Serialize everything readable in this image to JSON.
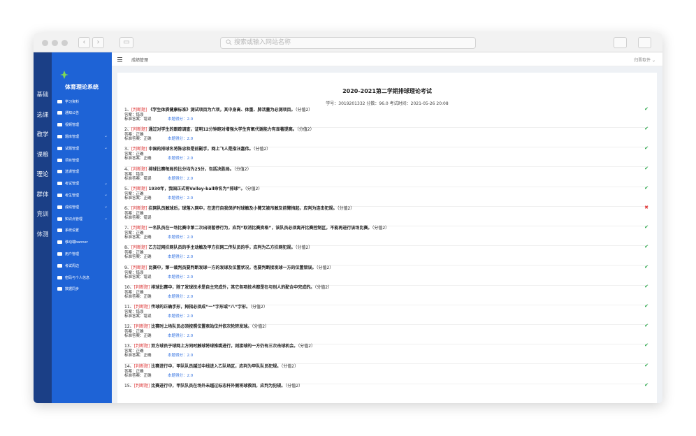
{
  "browser": {
    "address_placeholder": "搜索或输入网站名称",
    "colors": {
      "chrome": "#f2f2f2"
    }
  },
  "rail": [
    "基础",
    "选课",
    "教学",
    "课粮",
    "理论",
    "群体",
    "竞训",
    "体测"
  ],
  "rail_active": 4,
  "sidebar": {
    "title": "体育理论系统",
    "items": [
      {
        "label": "学习资料",
        "icon": "book-icon",
        "chevron": false
      },
      {
        "label": "通知公告",
        "icon": "mail-icon",
        "chevron": false
      },
      {
        "label": "视频管理",
        "icon": "video-icon",
        "chevron": false
      },
      {
        "label": "题库管理",
        "icon": "list-icon",
        "chevron": true
      },
      {
        "label": "试题管理",
        "icon": "grid-icon",
        "chevron": true
      },
      {
        "label": "项目管理",
        "icon": "wrench-icon",
        "chevron": false
      },
      {
        "label": "选课管理",
        "icon": "monitor-icon",
        "chevron": false
      },
      {
        "label": "考试管理",
        "icon": "bell-icon",
        "chevron": true
      },
      {
        "label": "考生管理",
        "icon": "users-icon",
        "chevron": true
      },
      {
        "label": "成绩管理",
        "icon": "table-icon",
        "chevron": true
      },
      {
        "label": "知识点管理",
        "icon": "tag-icon",
        "chevron": true
      },
      {
        "label": "系统设置",
        "icon": "gear-icon",
        "chevron": false
      },
      {
        "label": "移动端banner",
        "icon": "mail-icon",
        "chevron": false
      },
      {
        "label": "用户管理",
        "icon": "user-icon",
        "chevron": false
      },
      {
        "label": "考试周边",
        "icon": "mail-icon",
        "chevron": false
      },
      {
        "label": "密码与个人信息",
        "icon": "key-icon",
        "chevron": false
      },
      {
        "label": "数据同步",
        "icon": "sync-icon",
        "chevron": false
      }
    ],
    "colors": {
      "rail": "#1b3f86",
      "menu": "#1e63d6"
    }
  },
  "topbar": {
    "breadcrumb": "成绩管理",
    "user": "归晋软件 ⌄"
  },
  "exam": {
    "title": "2020-2021第二学期排球理论考试",
    "meta": "学号：3019201332 分数：96.0 考试时间：2021-05-26 20:08"
  },
  "questions": [
    {
      "num": "1、",
      "tag": "[判断题]",
      "stem": "《学生体质健康标准》测试项目为六项，其中身高、体重、肺活量为必测项目。",
      "score": "（分值2）",
      "answer": "答案：错误",
      "standard": "标准答案：错误",
      "got": "本题得分：2.0",
      "correct": true
    },
    {
      "num": "2、",
      "tag": "[判断题]",
      "stem": "通过对学生的跟踪调查，证明12分钟跑对增强大学生有氧代谢能力有显著提高。",
      "score": "（分值2）",
      "answer": "答案：正确",
      "standard": "标准答案：正确",
      "got": "本题得分：2.0",
      "correct": true
    },
    {
      "num": "3、",
      "tag": "[判断题]",
      "stem": "中国的排球名将陈忠和是前副手，网上飞人是指汪嘉伟。",
      "score": "（分值2）",
      "answer": "答案：正确",
      "standard": "标准答案：正确",
      "got": "本题得分：2.0",
      "correct": true
    },
    {
      "num": "4、",
      "tag": "[判断题]",
      "stem": "排球比赛每局的比分均为25分，包括决胜局。",
      "score": "（分值2）",
      "answer": "答案：错误",
      "standard": "标准答案：错误",
      "got": "本题得分：2.0",
      "correct": true
    },
    {
      "num": "5、",
      "tag": "[判断题]",
      "stem": "1930年，我国正式将Volley-ball命名为“排球”。",
      "score": "（分值2）",
      "answer": "答案：正确",
      "standard": "标准答案：正确",
      "got": "本题得分：2.0",
      "correct": true
    },
    {
      "num": "6、",
      "tag": "[判断题]",
      "stem": "拦网队员触球后，球落入网中，在进行自我保护时球触及小臂又被吊触及前臂挡起，应判为连击犯规。",
      "score": "（分值2）",
      "answer": "答案：正确",
      "standard": "标准答案：错误",
      "got": "",
      "correct": false
    },
    {
      "num": "7、",
      "tag": "[判断题]",
      "stem": "一名队员在一场比赛中第二次出现暂停行为，应判“取消比赛资格”，该队员必须离开比赛控制区，不能再进行该场比赛。",
      "score": "（分值2）",
      "answer": "答案：正确",
      "standard": "标准答案：正确",
      "got": "本题得分：2.0",
      "correct": true
    },
    {
      "num": "8、",
      "tag": "[判断题]",
      "stem": "乙方过网拦网队员的手主动触及甲方拦网二传队员的手，应判为乙方拦网犯规。",
      "score": "（分值2）",
      "answer": "答案：正确",
      "standard": "标准答案：正确",
      "got": "本题得分：2.0",
      "correct": true
    },
    {
      "num": "9、",
      "tag": "[判断题]",
      "stem": "比赛中，第一裁判员要判断发球一方的发球及位置状况，也要判断接发球一方的位置错误。",
      "score": "（分值2）",
      "answer": "答案：错误",
      "standard": "标准答案：错误",
      "got": "本题得分：2.0",
      "correct": true
    },
    {
      "num": "10、",
      "tag": "[判断题]",
      "stem": "排球比赛中，除了发球技术是自主完成外，其它各项技术都是在与别人的配合中完成的。",
      "score": "（分值2）",
      "answer": "答案：正确",
      "standard": "标准答案：正确",
      "got": "本题得分：2.0",
      "correct": true
    },
    {
      "num": "11、",
      "tag": "[判断题]",
      "stem": "传球的正确手形，拇指必须成“一”字形或“八”字形。",
      "score": "（分值2）",
      "answer": "答案：错误",
      "standard": "标准答案：错误",
      "got": "本题得分：2.0",
      "correct": true
    },
    {
      "num": "12、",
      "tag": "[判断题]",
      "stem": "比赛时上场队员必须按照位置表站位并依次轮转发球。",
      "score": "（分值2）",
      "answer": "答案：正确",
      "standard": "标准答案：正确",
      "got": "本题得分：2.0",
      "correct": true
    },
    {
      "num": "13、",
      "tag": "[判断题]",
      "stem": "双方球员于球网上方同时触球将球推跳进行，则接球的一方仍有三次击球机会。",
      "score": "（分值2）",
      "answer": "答案：正确",
      "standard": "标准答案：正确",
      "got": "本题得分：2.0",
      "correct": true
    },
    {
      "num": "14、",
      "tag": "[判断题]",
      "stem": "比赛进行中，甲队队员越过中线进入乙队场区，应判为甲队队员犯规。",
      "score": "（分值2）",
      "answer": "答案：正确",
      "standard": "标准答案：正确",
      "got": "本题得分：2.0",
      "correct": true
    },
    {
      "num": "15、",
      "tag": "[判断题]",
      "stem": "比赛进行中，甲队队员在场外未越过标志杆外侧将球救回，应判为犯规。",
      "score": "（分值2）",
      "answer": "",
      "standard": "",
      "got": "",
      "correct": true
    }
  ],
  "colors": {
    "correct": "#2aa64a",
    "wrong": "#e03b3b",
    "tag": "#e03b3b",
    "score_link": "#2f6fe0"
  }
}
